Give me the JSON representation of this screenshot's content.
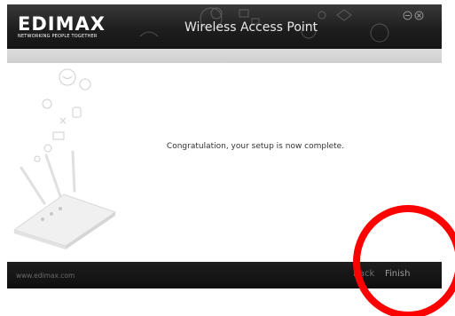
{
  "header": {
    "logo": "EDIMAX",
    "tagline": "NETWORKING PEOPLE TOGETHER",
    "title": "Wireless Access Point"
  },
  "main": {
    "message": "Congratulation, your setup is now complete."
  },
  "footer": {
    "url": "www.edimax.com",
    "back_label": "Back",
    "finish_label": "Finish"
  },
  "annotation": {
    "circle_color": "#ff0000"
  },
  "icons": [
    "minimize-icon",
    "close-icon",
    "router-image"
  ]
}
